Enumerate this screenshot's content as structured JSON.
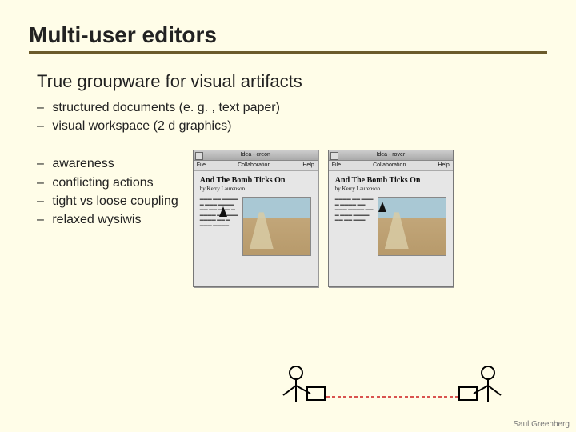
{
  "title": "Multi-user editors",
  "subtitle": "True groupware for visual artifacts",
  "group1": [
    "structured documents (e. g. , text paper)",
    "visual workspace (2 d graphics)"
  ],
  "group2": [
    "awareness",
    "conflicting actions",
    "tight vs  loose coupling",
    "relaxed wysiwis"
  ],
  "windows": [
    {
      "titlebar": "Idea - creon",
      "menu_left": "File",
      "menu_mid": "Collaboration",
      "menu_right": "Help",
      "doc_title": "And The Bomb Ticks On",
      "byline": "by Kerry Laurenson"
    },
    {
      "titlebar": "Idea - rover",
      "menu_left": "File",
      "menu_mid": "Collaboration",
      "menu_right": "Help",
      "doc_title": "And The Bomb Ticks On",
      "byline": "by Kerry Laurenson"
    }
  ],
  "footer": "Saul Greenberg"
}
